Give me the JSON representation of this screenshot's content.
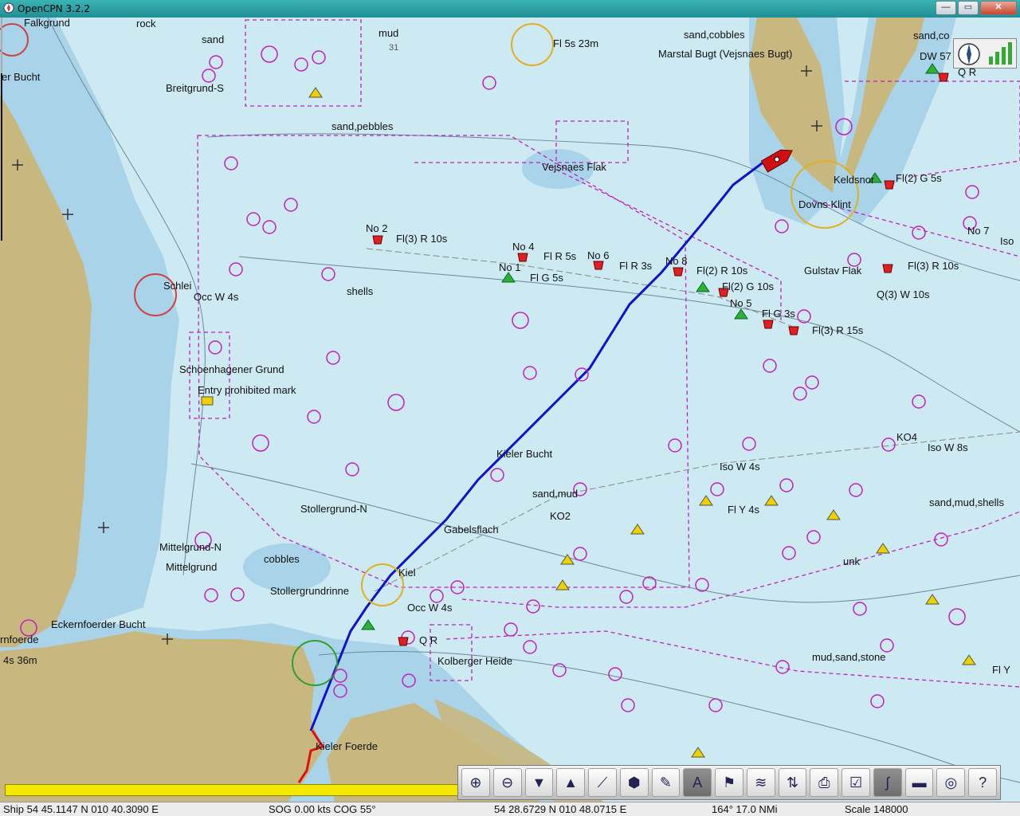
{
  "window": {
    "title": "OpenCPN 3.2.2",
    "minimize_label": "—",
    "maximize_label": "▭",
    "close_label": "✕"
  },
  "colors": {
    "water": "#c9e6ef",
    "shallow": "#8fc3de",
    "land": "#c8b77f",
    "route": "#1010d0",
    "track": "#e01010",
    "restricted": "#c020c0"
  },
  "chart_labels": [
    {
      "text": "Falkgrund"
    },
    {
      "text": "rock"
    },
    {
      "text": "sand"
    },
    {
      "text": "mud"
    },
    {
      "text": "31"
    },
    {
      "text": "Breitgrund-S"
    },
    {
      "text": "er Bucht"
    },
    {
      "text": "sand,pebbles"
    },
    {
      "text": "Fl 5s 23m"
    },
    {
      "text": "sand,cobbles"
    },
    {
      "text": "Marstal Bugt (Vejsnaes Bugt)"
    },
    {
      "text": "sand,co"
    },
    {
      "text": "DW 57"
    },
    {
      "text": "Q R"
    },
    {
      "text": "Vejsnaes Flak"
    },
    {
      "text": "Keldsnor"
    },
    {
      "text": "Fl(2) G 5s"
    },
    {
      "text": "Dovns Klint"
    },
    {
      "text": "No 2"
    },
    {
      "text": "Fl(3) R 10s"
    },
    {
      "text": "No 4"
    },
    {
      "text": "Fl R 5s"
    },
    {
      "text": "No 6"
    },
    {
      "text": "Fl R 3s"
    },
    {
      "text": "No 1"
    },
    {
      "text": "Fl G 5s"
    },
    {
      "text": "No 8"
    },
    {
      "text": "Fl(2) R 10s"
    },
    {
      "text": "Fl(2) G 10s"
    },
    {
      "text": "No 5"
    },
    {
      "text": "Fl G 3s"
    },
    {
      "text": "Fl(3) R 15s"
    },
    {
      "text": "Gulstav Flak"
    },
    {
      "text": "Fl(3) R 10s"
    },
    {
      "text": "Q(3) W 10s"
    },
    {
      "text": "No 7"
    },
    {
      "text": "Iso"
    },
    {
      "text": "Schlei"
    },
    {
      "text": "Occ W 4s"
    },
    {
      "text": "shells"
    },
    {
      "text": "Schoenhagener Grund"
    },
    {
      "text": "Entry prohibited mark"
    },
    {
      "text": "Kieler Bucht"
    },
    {
      "text": "KO4"
    },
    {
      "text": "Iso W 8s"
    },
    {
      "text": "Iso W 4s"
    },
    {
      "text": "sand,mud"
    },
    {
      "text": "Fl Y 4s"
    },
    {
      "text": "sand,mud,shells"
    },
    {
      "text": "Stollergrund-N"
    },
    {
      "text": "KO2"
    },
    {
      "text": "Gabelsflach"
    },
    {
      "text": "Mittelgrund-N"
    },
    {
      "text": "Mittelgrund"
    },
    {
      "text": "cobbles"
    },
    {
      "text": "Stollergrundrinne"
    },
    {
      "text": "Kiel"
    },
    {
      "text": "Occ W 4s"
    },
    {
      "text": "unk"
    },
    {
      "text": "Eckernfoerder Bucht"
    },
    {
      "text": "rnfoerde"
    },
    {
      "text": "Q R"
    },
    {
      "text": "Kolberger Heide"
    },
    {
      "text": "mud,sand,stone"
    },
    {
      "text": "4s 36m"
    },
    {
      "text": "Kieler Foerde"
    },
    {
      "text": "Fl Y"
    }
  ],
  "toolbar": {
    "buttons": [
      {
        "icon": "zoom-in-icon",
        "glyph": "⊕"
      },
      {
        "icon": "zoom-out-icon",
        "glyph": "⊖"
      },
      {
        "icon": "scale-in-icon",
        "glyph": "▼"
      },
      {
        "icon": "scale-out-icon",
        "glyph": "▲"
      },
      {
        "icon": "route-icon",
        "glyph": "⟋"
      },
      {
        "icon": "auto-follow-icon",
        "glyph": "⬢"
      },
      {
        "icon": "settings-icon",
        "glyph": "✎"
      },
      {
        "icon": "text-toggle-icon",
        "glyph": "A"
      },
      {
        "icon": "current-icon",
        "glyph": "⚑"
      },
      {
        "icon": "tide-icon",
        "glyph": "≋"
      },
      {
        "icon": "current-arrow-icon",
        "glyph": "⇅"
      },
      {
        "icon": "print-icon",
        "glyph": "⎙"
      },
      {
        "icon": "route-manager-icon",
        "glyph": "☑"
      },
      {
        "icon": "track-icon",
        "glyph": "∫"
      },
      {
        "icon": "color-scheme-icon",
        "glyph": "▬"
      },
      {
        "icon": "mob-icon",
        "glyph": "◎"
      },
      {
        "icon": "help-icon",
        "glyph": "?"
      }
    ]
  },
  "status": {
    "ship": "Ship 54 45.1147 N   010 40.3090 E",
    "sog_cog": "SOG 0.00 kts   COG 55°",
    "cursor": "54 28.6729 N   010 48.0715 E",
    "bearing": "164°   17.0 NMi",
    "scale": "Scale 148000"
  }
}
